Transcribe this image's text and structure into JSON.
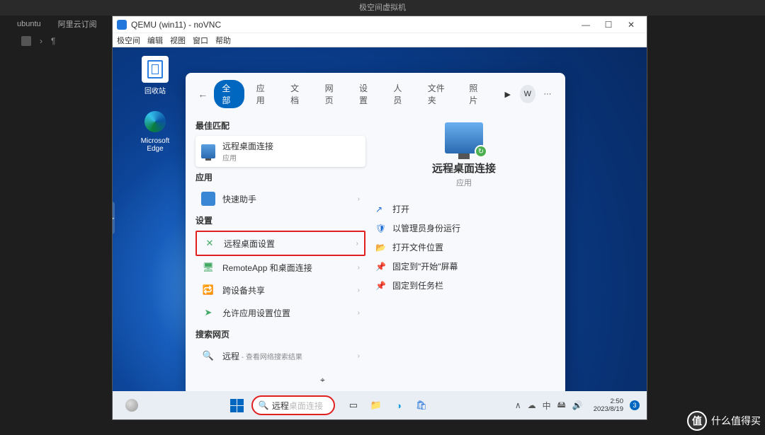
{
  "host": {
    "title": "极空间虚拟机",
    "tabs": [
      "ubuntu",
      "阿里云订阅"
    ],
    "crumb_sep": "›",
    "crumb_end": "¶"
  },
  "vnc": {
    "title": "QEMU (win11) - noVNC",
    "menu": [
      "极空间",
      "编辑",
      "视图",
      "窗口",
      "帮助"
    ],
    "btn_min": "—",
    "btn_max": "☐",
    "btn_close": "✕"
  },
  "desktop_icons": {
    "recycle": "回收站",
    "edge": "Microsoft Edge"
  },
  "side_tab": "▶",
  "start": {
    "back": "←",
    "tabs": [
      "全部",
      "应用",
      "文档",
      "网页",
      "设置",
      "人员",
      "文件夹",
      "照片"
    ],
    "play": "▶",
    "avatar": "W",
    "more": "···",
    "sec_best": "最佳匹配",
    "best": {
      "title": "远程桌面连接",
      "sub": "应用"
    },
    "sec_apps": "应用",
    "apps": [
      {
        "title": "快速助手",
        "icon": "🖥"
      }
    ],
    "sec_settings": "设置",
    "settings": [
      {
        "title": "远程桌面设置",
        "icon": "✕"
      },
      {
        "title": "RemoteApp 和桌面连接",
        "icon": "🖥"
      },
      {
        "title": "跨设备共享",
        "icon": "🔁"
      },
      {
        "title": "允许应用设置位置",
        "icon": "➤"
      }
    ],
    "sec_web": "搜索网页",
    "web": {
      "prefix": "远程",
      "suffix": " - 查看网络搜索结果",
      "icon": "🔍"
    },
    "chev": "›",
    "preview": {
      "title": "远程桌面连接",
      "sub": "应用",
      "actions": [
        {
          "icon": "↗",
          "label": "打开"
        },
        {
          "icon": "🛡",
          "label": "以管理员身份运行"
        },
        {
          "icon": "📂",
          "label": "打开文件位置"
        },
        {
          "icon": "📌",
          "label": "固定到\"开始\"屏幕"
        },
        {
          "icon": "📌",
          "label": "固定到任务栏"
        }
      ]
    }
  },
  "taskbar": {
    "search_typed": "远程",
    "search_hint": "桌面连接",
    "pins_colors": [
      "#333",
      "#f4c542",
      "#1a9edc",
      "#c0392b",
      "#1a6dd8"
    ],
    "tray": [
      "∧",
      "☁",
      "中",
      "🖴",
      "🔊"
    ],
    "time": "2:50",
    "date": "2023/8/19",
    "notif": "3"
  },
  "watermark": "什么值得买",
  "cursor_glyph": "⌖"
}
